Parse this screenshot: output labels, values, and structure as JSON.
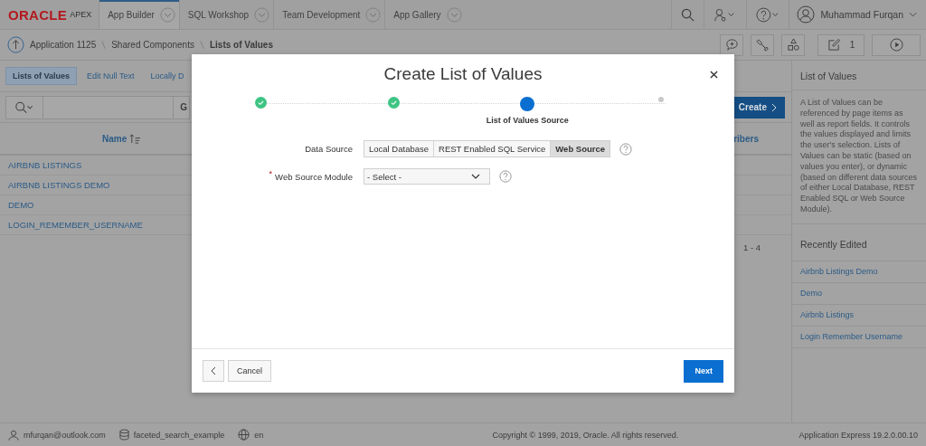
{
  "header": {
    "logo": {
      "brand": "ORACLE",
      "product": "APEX"
    },
    "nav_tabs": [
      {
        "label": "App Builder",
        "selected": true
      },
      {
        "label": "SQL Workshop",
        "selected": false
      },
      {
        "label": "Team Development",
        "selected": false
      },
      {
        "label": "App Gallery",
        "selected": false
      }
    ],
    "user": "Muhammad Furqan"
  },
  "breadcrumb": [
    "Application 1125",
    "Shared Components",
    "Lists of Values"
  ],
  "edit_count": "1",
  "page_tabs": [
    {
      "label": "Lists of Values",
      "selected": true
    },
    {
      "label": "Edit Null Text",
      "selected": false
    },
    {
      "label": "Locally D",
      "selected": false
    }
  ],
  "search": {
    "go_label": "G"
  },
  "create_button": "Create",
  "table": {
    "columns": [
      "Name",
      "ribers"
    ],
    "rows": [
      "AIRBNB LISTINGS",
      "AIRBNB LISTINGS DEMO",
      "DEMO",
      "LOGIN_REMEMBER_USERNAME"
    ],
    "pagination": "1 - 4"
  },
  "help_panel": {
    "title": "List of Values",
    "text": "A List of Values can be referenced by page items as well as report fields. It controls the values displayed and limits the user's selection. Lists of Values can be static (based on values you enter), or dynamic (based on different data sources of either Local Database, REST Enabled SQL or Web Source Module).",
    "recent_title": "Recently Edited",
    "recent": [
      "Airbnb Listings Demo",
      "Demo",
      "Airbnb Listings",
      "Login Remember Username"
    ]
  },
  "dialog": {
    "title": "Create List of Values",
    "steps": [
      {
        "complete": true,
        "current": false
      },
      {
        "complete": true,
        "current": false
      },
      {
        "complete": false,
        "current": true,
        "label": "List of Values Source"
      },
      {
        "complete": false,
        "current": false
      }
    ],
    "fields": [
      {
        "kind": "segmented",
        "label": "Data Source",
        "options": [
          {
            "label": "Local Database",
            "selected": false
          },
          {
            "label": "REST Enabled SQL Service",
            "selected": false
          },
          {
            "label": "Web Source",
            "selected": true
          }
        ]
      },
      {
        "kind": "select",
        "label": "Web Source Module",
        "required_mark": "*",
        "value": "- Select -"
      }
    ],
    "cancel": "Cancel",
    "next": "Next"
  },
  "status_bar": {
    "user": "mfurqan@outlook.com",
    "schema": "faceted_search_example",
    "language": "en",
    "copyright": "Copyright © 1999, 2019, Oracle. All rights reserved.",
    "version": "Application Express 19.2.0.00.10"
  }
}
